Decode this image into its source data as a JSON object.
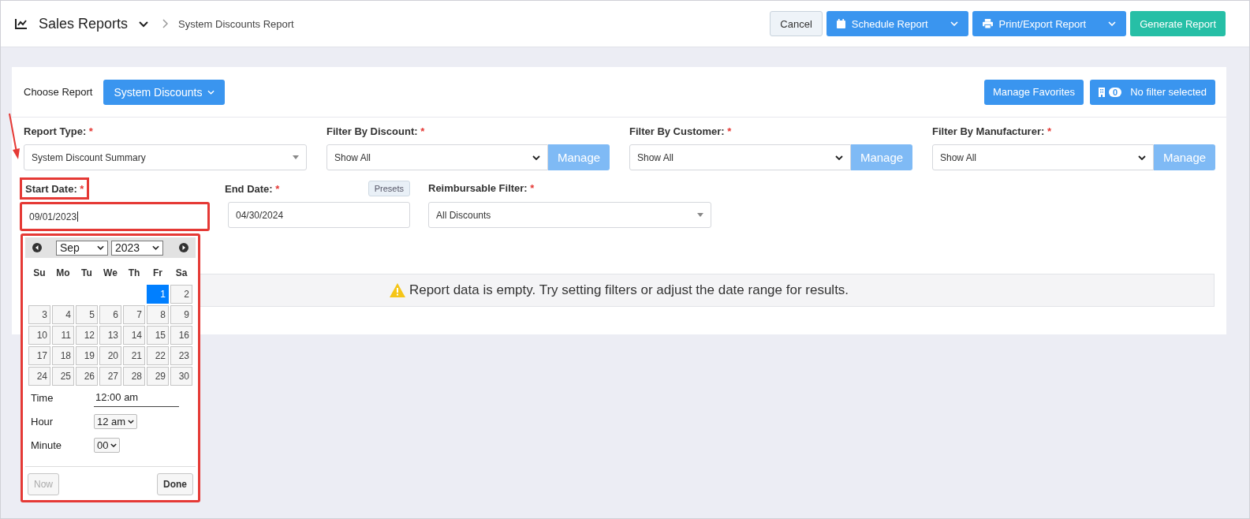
{
  "header": {
    "title": "Sales Reports",
    "breadcrumb": "System Discounts Report",
    "buttons": [
      {
        "label": "Cancel",
        "kind": "plain"
      },
      {
        "label": "Schedule Report",
        "kind": "calendar-split"
      },
      {
        "label": "Print/Export Report",
        "kind": "printer-split"
      },
      {
        "label": "Generate Report",
        "kind": "teal"
      }
    ]
  },
  "toolbar": {
    "label": "Choose Report",
    "report": "System Discounts",
    "favorites": "Manage Favorites",
    "filter_count": "0",
    "filter_status": "No filter selected"
  },
  "filters": [
    {
      "label": "Report Type:",
      "mark": "*",
      "value": "System Discount Summary",
      "kind": "select"
    },
    {
      "label": "Filter By Discount:",
      "mark": "*",
      "value": "Show All",
      "kind": "managed",
      "button": "Manage"
    },
    {
      "label": "Filter By Customer:",
      "mark": "*",
      "value": "Show All",
      "kind": "managed",
      "button": "Manage"
    },
    {
      "label": "Filter By Manufacturer:",
      "mark": "*",
      "value": "Show All",
      "kind": "managed",
      "button": "Manage"
    }
  ],
  "start_date": {
    "label": "Start Date:",
    "mark": "*",
    "value": "09/01/2023",
    "highlighted": true
  },
  "end_date": {
    "label": "End Date:",
    "mark": "*",
    "value": "04/30/2024",
    "presets": "Presets"
  },
  "reimbursable": {
    "label": "Reimbursable Filter:",
    "mark": "*",
    "value": "All Discounts"
  },
  "datepicker": {
    "highlighted": true,
    "month": "Sep",
    "year": "2023",
    "weekdays": [
      "Su",
      "Mo",
      "Tu",
      "We",
      "Th",
      "Fr",
      "Sa"
    ],
    "weeks": [
      [
        {
          "day": "1",
          "selected": true
        },
        {
          "day": "2",
          "selected": false
        }
      ],
      [
        {
          "day": "3",
          "selected": false
        },
        {
          "day": "4",
          "selected": false
        },
        {
          "day": "5",
          "selected": false
        },
        {
          "day": "6",
          "selected": false
        },
        {
          "day": "7",
          "selected": false
        },
        {
          "day": "8",
          "selected": false
        },
        {
          "day": "9",
          "selected": false
        }
      ],
      [
        {
          "day": "10",
          "selected": false
        },
        {
          "day": "11",
          "selected": false
        },
        {
          "day": "12",
          "selected": false
        },
        {
          "day": "13",
          "selected": false
        },
        {
          "day": "14",
          "selected": false
        },
        {
          "day": "15",
          "selected": false
        },
        {
          "day": "16",
          "selected": false
        }
      ],
      [
        {
          "day": "17",
          "selected": false
        },
        {
          "day": "18",
          "selected": false
        },
        {
          "day": "19",
          "selected": false
        },
        {
          "day": "20",
          "selected": false
        },
        {
          "day": "21",
          "selected": false
        },
        {
          "day": "22",
          "selected": false
        },
        {
          "day": "23",
          "selected": false
        }
      ],
      [
        {
          "day": "24",
          "selected": false
        },
        {
          "day": "25",
          "selected": false
        },
        {
          "day": "26",
          "selected": false
        },
        {
          "day": "27",
          "selected": false
        },
        {
          "day": "28",
          "selected": false
        },
        {
          "day": "29",
          "selected": false
        },
        {
          "day": "30",
          "selected": false
        }
      ]
    ],
    "time_label": "Time",
    "time_value": "12:00 am",
    "hour_label": "Hour",
    "hour_value": "12 am",
    "minute_label": "Minute",
    "minute_value": "00",
    "buttons": [
      {
        "label": "Now",
        "disabled": true
      },
      {
        "label": "Done",
        "disabled": false
      }
    ]
  },
  "empty_message": "Report data is empty. Try setting filters or adjust the date range for results."
}
